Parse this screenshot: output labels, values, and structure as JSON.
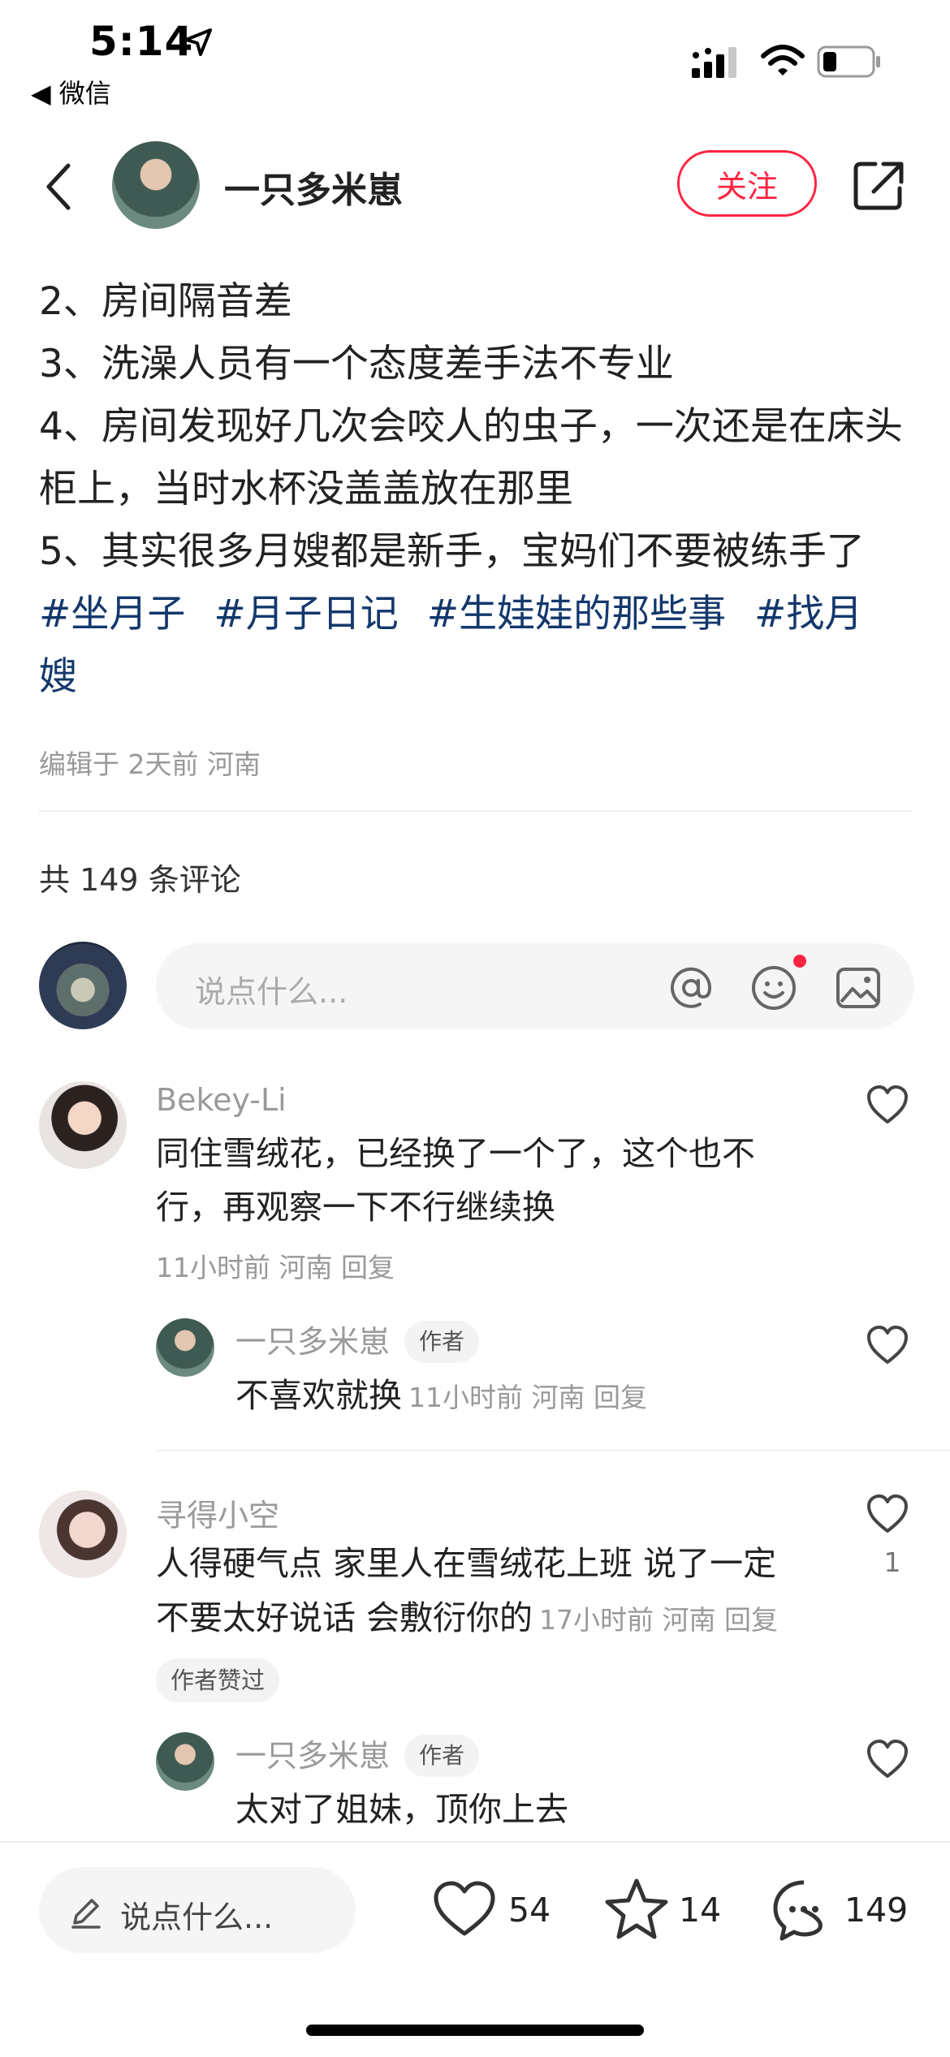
{
  "status_bar": {
    "time": "5:14",
    "back_app": "◀ 微信"
  },
  "header": {
    "author_name": "一只多米崽",
    "follow_label": "关注"
  },
  "post": {
    "lines": [
      "2、房间隔音差",
      "3、洗澡人员有一个态度差手法不专业",
      "4、房间发现好几次会咬人的虫子，一次还是在床头柜上，当时水杯没盖盖放在那里",
      "5、其实很多月嫂都是新手，宝妈们不要被练手了"
    ],
    "tags": [
      "#坐月子",
      "#月子日记",
      "#生娃娃的那些事",
      "#找月嫂"
    ],
    "edit_meta": "编辑于 2天前 河南"
  },
  "comments_section": {
    "count_label": "共 149 条评论",
    "input_placeholder": "说点什么..."
  },
  "comments": [
    {
      "name": "Bekey-Li",
      "text": "同住雪绒花，已经换了一个了，这个也不行，再观察一下不行继续换",
      "meta": "11小时前  河南  回复",
      "reply": {
        "name": "一只多米崽",
        "badge": "作者",
        "text": "不喜欢就换",
        "meta": "11小时前  河南  回复"
      }
    },
    {
      "name": "寻得小空",
      "text_line1": "人得硬气点 家里人在雪绒花上班 说了一定",
      "text_line2": "不要太好说话 会敷衍你的",
      "meta": "17小时前  河南  回复",
      "likes": "1",
      "liked_badge": "作者赞过",
      "reply": {
        "name": "一只多米崽",
        "badge": "作者",
        "text": "太对了姐妹，顶你上去"
      }
    }
  ],
  "bottom_bar": {
    "placeholder": "说点什么...",
    "likes": "54",
    "stars": "14",
    "comments": "149"
  },
  "colors": {
    "accent": "#ff2442",
    "tag": "#13386c"
  }
}
